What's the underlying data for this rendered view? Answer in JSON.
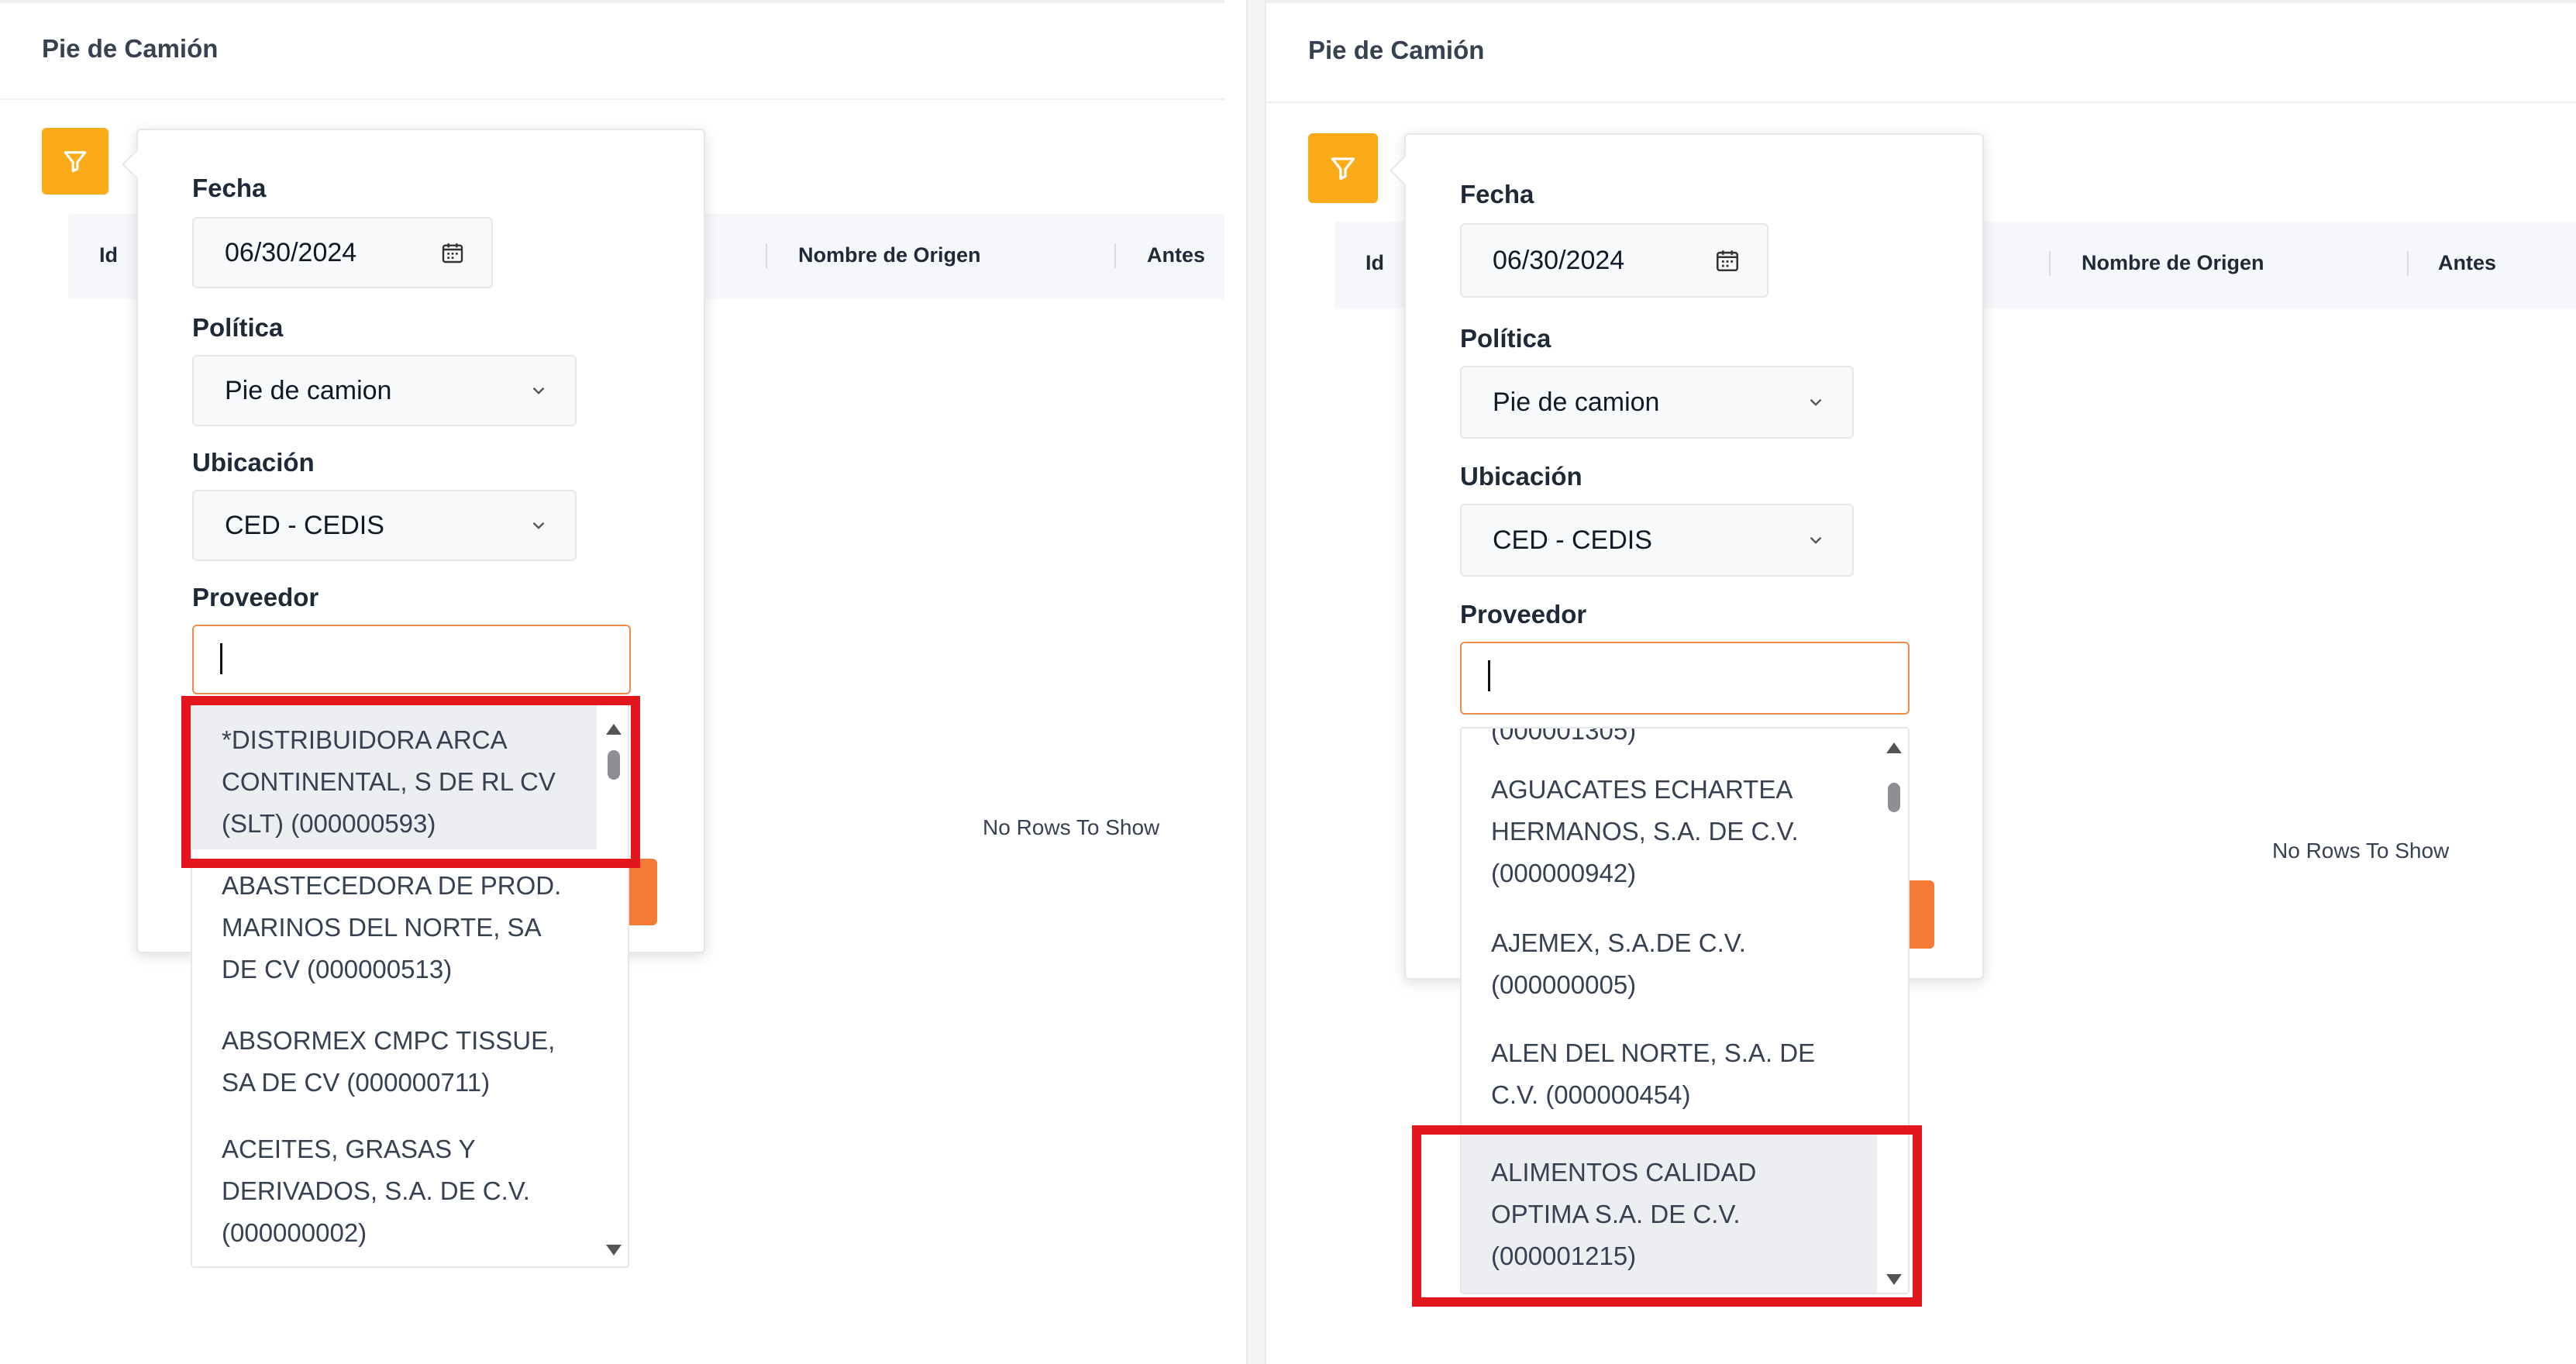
{
  "page_title": "Pie de Camión",
  "columns": {
    "id": "Id",
    "origin_name": "Nombre de Origen",
    "before": "Antes"
  },
  "empty_grid": "No Rows To Show",
  "filter": {
    "fecha_label": "Fecha",
    "fecha_value": "06/30/2024",
    "politica_label": "Política",
    "politica_value": "Pie de camion",
    "ubicacion_label": "Ubicación",
    "ubicacion_value": "CED - CEDIS",
    "proveedor_label": "Proveedor",
    "proveedor_value": ""
  },
  "left_options": [
    "*DISTRIBUIDORA ARCA",
    "CONTINENTAL, S DE RL CV",
    "(SLT) (000000593)",
    "ABASTECEDORA DE PROD.",
    "MARINOS DEL NORTE, SA",
    "DE CV (000000513)",
    "ABSORMEX CMPC TISSUE,",
    "SA DE CV (000000711)",
    "ACEITES, GRASAS Y",
    "DERIVADOS, S.A. DE C.V.",
    "(000000002)"
  ],
  "right_options": [
    "(000001305)",
    "AGUACATES ECHARTEA",
    "HERMANOS, S.A. DE C.V.",
    "(000000942)",
    "AJEMEX, S.A.DE C.V.",
    "(000000005)",
    "ALEN DEL NORTE, S.A. DE",
    "C.V. (000000454)",
    "ALIMENTOS CALIDAD",
    "OPTIMA S.A. DE C.V.",
    "(000001215)"
  ],
  "colors": {
    "accent_orange": "#f47b36",
    "filter_yellow": "#fbab18",
    "highlight_red": "#e3161d"
  },
  "icons": {
    "filter": "funnel-icon",
    "calendar": "calendar-icon",
    "dropdown": "chevron-down-icon"
  }
}
